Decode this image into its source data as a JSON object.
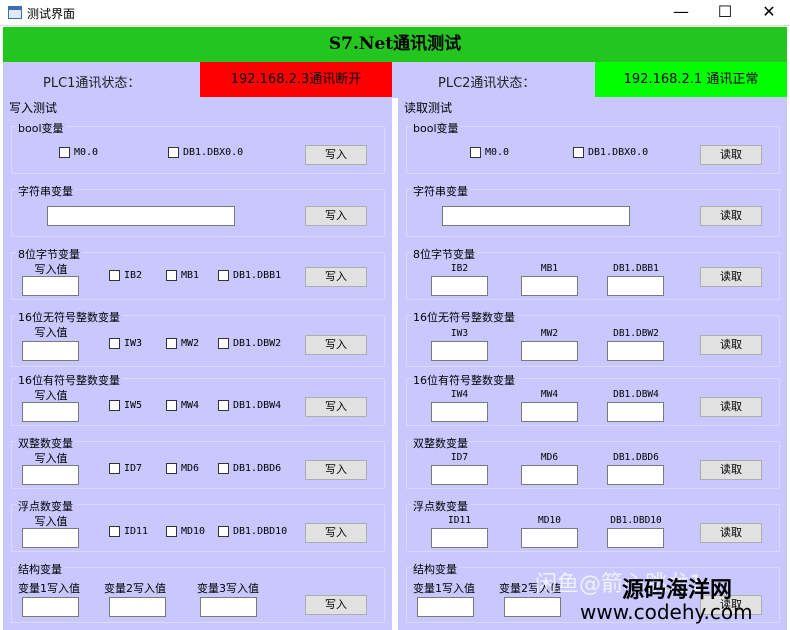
{
  "window": {
    "title": "测试界面",
    "minimize": "—",
    "maximize": "☐",
    "close": "✕"
  },
  "header": {
    "title": "S7.Net通讯测试"
  },
  "status": {
    "plc1_label": "PLC1通讯状态：",
    "plc1_value": "192.168.2.3通讯断开",
    "plc1_color": "#ff0000",
    "plc2_label": "PLC2通讯状态：",
    "plc2_value": "192.168.2.1 通讯正常",
    "plc2_color": "#00ff00"
  },
  "write": {
    "title": "写入测试",
    "button": "写入",
    "bool": {
      "title": "bool变量",
      "cb1": "M0.0",
      "cb2": "DB1.DBX0.0"
    },
    "string": {
      "title": "字符串变量"
    },
    "byte": {
      "title": "8位字节变量",
      "input_label": "写入值",
      "cb1": "IB2",
      "cb2": "MB1",
      "cb3": "DB1.DBB1"
    },
    "uint16": {
      "title": "16位无符号整数变量",
      "input_label": "写入值",
      "cb1": "IW3",
      "cb2": "MW2",
      "cb3": "DB1.DBW2"
    },
    "int16": {
      "title": "16位有符号整数变量",
      "input_label": "写入值",
      "cb1": "IW5",
      "cb2": "MW4",
      "cb3": "DB1.DBW4"
    },
    "dint": {
      "title": "双整数变量",
      "input_label": "写入值",
      "cb1": "ID7",
      "cb2": "MD6",
      "cb3": "DB1.DBD6"
    },
    "real": {
      "title": "浮点数变量",
      "input_label": "写入值",
      "cb1": "ID11",
      "cb2": "MD10",
      "cb3": "DB1.DBD10"
    },
    "struct": {
      "title": "结构变量",
      "l1": "变量1写入值",
      "l2": "变量2写入值",
      "l3": "变量3写入值"
    }
  },
  "read": {
    "title": "读取测试",
    "button": "读取",
    "bool": {
      "title": "bool变量",
      "cb1": "M0.0",
      "cb2": "DB1.DBX0.0"
    },
    "string": {
      "title": "字符串变量"
    },
    "byte": {
      "title": "8位字节变量",
      "l1": "IB2",
      "l2": "MB1",
      "l3": "DB1.DBB1"
    },
    "uint16": {
      "title": "16位无符号整数变量",
      "l1": "IW3",
      "l2": "MW2",
      "l3": "DB1.DBW2"
    },
    "int16": {
      "title": "16位有符号整数变量",
      "l1": "IW4",
      "l2": "MW4",
      "l3": "DB1.DBW4"
    },
    "dint": {
      "title": "双整数变量",
      "l1": "ID7",
      "l2": "MD6",
      "l3": "DB1.DBD6"
    },
    "real": {
      "title": "浮点数变量",
      "l1": "ID11",
      "l2": "MD10",
      "l3": "DB1.DBD10"
    },
    "struct": {
      "title": "结构变量",
      "l1": "变量1写入值",
      "l2": "变量2写入值"
    }
  },
  "watermark": {
    "text1": "闲鱼@箭心跳龙1",
    "text2": "源码海洋网",
    "text3": "www.codehy.com"
  }
}
